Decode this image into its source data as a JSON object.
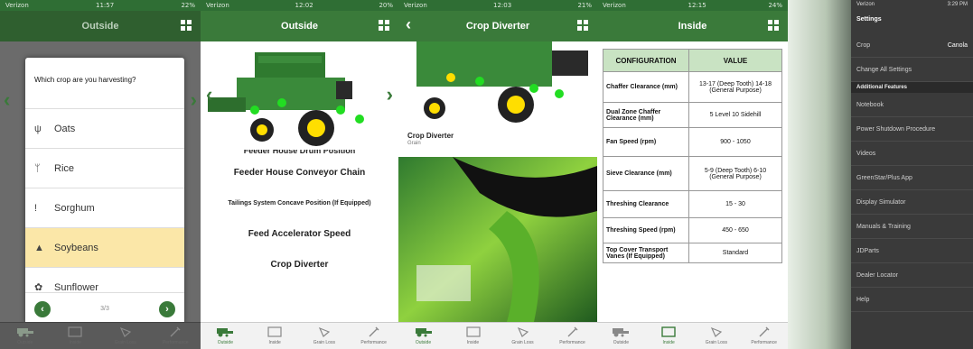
{
  "screens": {
    "s1": {
      "status": {
        "carrier": "Verizon",
        "time": "11:57",
        "battery": "22%"
      },
      "title": "Outside",
      "question": "Which crop are you harvesting?",
      "crops": [
        {
          "label": "Oats",
          "icon": "oats-icon",
          "glyph": "ψ",
          "selected": false
        },
        {
          "label": "Rice",
          "icon": "rice-icon",
          "glyph": "ᛘ",
          "selected": false
        },
        {
          "label": "Sorghum",
          "icon": "sorghum-icon",
          "glyph": "!",
          "selected": false
        },
        {
          "label": "Soybeans",
          "icon": "soybeans-icon",
          "glyph": "▲",
          "selected": true
        },
        {
          "label": "Sunflower",
          "icon": "sunflower-icon",
          "glyph": "✿",
          "selected": false
        }
      ],
      "pager": "3/3"
    },
    "s2": {
      "status": {
        "carrier": "Verizon",
        "time": "12:02",
        "battery": "20%"
      },
      "title": "Outside",
      "items": [
        "Feeder House Drum Position",
        "Feeder House Conveyor Chain",
        "Tailings System Concave Position (If Equipped)",
        "Feed Accelerator Speed",
        "Crop Diverter"
      ]
    },
    "s3": {
      "status": {
        "carrier": "Verizon",
        "time": "12:03",
        "battery": "21%"
      },
      "title": "Crop Diverter",
      "caption_title": "Crop Diverter",
      "caption_sub": "Grain"
    },
    "s4": {
      "status": {
        "carrier": "Verizon",
        "time": "12:15",
        "battery": "24%"
      },
      "title": "Inside",
      "headers": [
        "CONFIGURATION",
        "VALUE"
      ],
      "rows": [
        [
          "Chaffer Clearance (mm)",
          "13-17 (Deep Tooth) 14-18 (General Purpose)"
        ],
        [
          "Dual Zone Chaffer Clearance (mm)",
          "5 Level 10 Sidehill"
        ],
        [
          "Fan Speed (rpm)",
          "900 - 1050"
        ],
        [
          "Sieve Clearance (mm)",
          "5-9 (Deep Tooth) 6-10 (General Purpose)"
        ],
        [
          "Threshing Clearance",
          "15 - 30"
        ],
        [
          "Threshing Speed (rpm)",
          "450 - 650"
        ],
        [
          "Top Cover Transport Vanes (If Equipped)",
          "Standard"
        ]
      ]
    },
    "s5": {
      "status": {
        "carrier": "Verizon",
        "time": "3:29 PM"
      },
      "title": "Settings",
      "crop_label": "Crop",
      "crop_value": "Canola",
      "change_all": "Change All Settings",
      "section": "Additional Features",
      "features": [
        "Notebook",
        "Power Shutdown Procedure",
        "Videos",
        "GreenStar/Plus App",
        "Display Simulator",
        "Manuals & Training",
        "JDParts",
        "Dealer Locator",
        "Help"
      ]
    }
  },
  "tabs": [
    "Outside",
    "Inside",
    "Grain Loss",
    "Performance"
  ],
  "colors": {
    "brand_green": "#3a7a3a",
    "brand_yellow": "#ffde00",
    "highlight": "#fbe7a8"
  }
}
